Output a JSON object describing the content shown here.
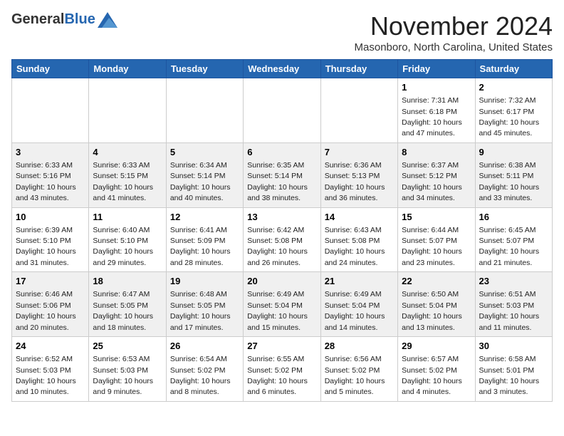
{
  "header": {
    "logo_general": "General",
    "logo_blue": "Blue",
    "month_title": "November 2024",
    "location": "Masonboro, North Carolina, United States"
  },
  "weekdays": [
    "Sunday",
    "Monday",
    "Tuesday",
    "Wednesday",
    "Thursday",
    "Friday",
    "Saturday"
  ],
  "weeks": [
    [
      {
        "day": "",
        "info": ""
      },
      {
        "day": "",
        "info": ""
      },
      {
        "day": "",
        "info": ""
      },
      {
        "day": "",
        "info": ""
      },
      {
        "day": "",
        "info": ""
      },
      {
        "day": "1",
        "info": "Sunrise: 7:31 AM\nSunset: 6:18 PM\nDaylight: 10 hours and 47 minutes."
      },
      {
        "day": "2",
        "info": "Sunrise: 7:32 AM\nSunset: 6:17 PM\nDaylight: 10 hours and 45 minutes."
      }
    ],
    [
      {
        "day": "3",
        "info": "Sunrise: 6:33 AM\nSunset: 5:16 PM\nDaylight: 10 hours and 43 minutes."
      },
      {
        "day": "4",
        "info": "Sunrise: 6:33 AM\nSunset: 5:15 PM\nDaylight: 10 hours and 41 minutes."
      },
      {
        "day": "5",
        "info": "Sunrise: 6:34 AM\nSunset: 5:14 PM\nDaylight: 10 hours and 40 minutes."
      },
      {
        "day": "6",
        "info": "Sunrise: 6:35 AM\nSunset: 5:14 PM\nDaylight: 10 hours and 38 minutes."
      },
      {
        "day": "7",
        "info": "Sunrise: 6:36 AM\nSunset: 5:13 PM\nDaylight: 10 hours and 36 minutes."
      },
      {
        "day": "8",
        "info": "Sunrise: 6:37 AM\nSunset: 5:12 PM\nDaylight: 10 hours and 34 minutes."
      },
      {
        "day": "9",
        "info": "Sunrise: 6:38 AM\nSunset: 5:11 PM\nDaylight: 10 hours and 33 minutes."
      }
    ],
    [
      {
        "day": "10",
        "info": "Sunrise: 6:39 AM\nSunset: 5:10 PM\nDaylight: 10 hours and 31 minutes."
      },
      {
        "day": "11",
        "info": "Sunrise: 6:40 AM\nSunset: 5:10 PM\nDaylight: 10 hours and 29 minutes."
      },
      {
        "day": "12",
        "info": "Sunrise: 6:41 AM\nSunset: 5:09 PM\nDaylight: 10 hours and 28 minutes."
      },
      {
        "day": "13",
        "info": "Sunrise: 6:42 AM\nSunset: 5:08 PM\nDaylight: 10 hours and 26 minutes."
      },
      {
        "day": "14",
        "info": "Sunrise: 6:43 AM\nSunset: 5:08 PM\nDaylight: 10 hours and 24 minutes."
      },
      {
        "day": "15",
        "info": "Sunrise: 6:44 AM\nSunset: 5:07 PM\nDaylight: 10 hours and 23 minutes."
      },
      {
        "day": "16",
        "info": "Sunrise: 6:45 AM\nSunset: 5:07 PM\nDaylight: 10 hours and 21 minutes."
      }
    ],
    [
      {
        "day": "17",
        "info": "Sunrise: 6:46 AM\nSunset: 5:06 PM\nDaylight: 10 hours and 20 minutes."
      },
      {
        "day": "18",
        "info": "Sunrise: 6:47 AM\nSunset: 5:05 PM\nDaylight: 10 hours and 18 minutes."
      },
      {
        "day": "19",
        "info": "Sunrise: 6:48 AM\nSunset: 5:05 PM\nDaylight: 10 hours and 17 minutes."
      },
      {
        "day": "20",
        "info": "Sunrise: 6:49 AM\nSunset: 5:04 PM\nDaylight: 10 hours and 15 minutes."
      },
      {
        "day": "21",
        "info": "Sunrise: 6:49 AM\nSunset: 5:04 PM\nDaylight: 10 hours and 14 minutes."
      },
      {
        "day": "22",
        "info": "Sunrise: 6:50 AM\nSunset: 5:04 PM\nDaylight: 10 hours and 13 minutes."
      },
      {
        "day": "23",
        "info": "Sunrise: 6:51 AM\nSunset: 5:03 PM\nDaylight: 10 hours and 11 minutes."
      }
    ],
    [
      {
        "day": "24",
        "info": "Sunrise: 6:52 AM\nSunset: 5:03 PM\nDaylight: 10 hours and 10 minutes."
      },
      {
        "day": "25",
        "info": "Sunrise: 6:53 AM\nSunset: 5:03 PM\nDaylight: 10 hours and 9 minutes."
      },
      {
        "day": "26",
        "info": "Sunrise: 6:54 AM\nSunset: 5:02 PM\nDaylight: 10 hours and 8 minutes."
      },
      {
        "day": "27",
        "info": "Sunrise: 6:55 AM\nSunset: 5:02 PM\nDaylight: 10 hours and 6 minutes."
      },
      {
        "day": "28",
        "info": "Sunrise: 6:56 AM\nSunset: 5:02 PM\nDaylight: 10 hours and 5 minutes."
      },
      {
        "day": "29",
        "info": "Sunrise: 6:57 AM\nSunset: 5:02 PM\nDaylight: 10 hours and 4 minutes."
      },
      {
        "day": "30",
        "info": "Sunrise: 6:58 AM\nSunset: 5:01 PM\nDaylight: 10 hours and 3 minutes."
      }
    ]
  ]
}
